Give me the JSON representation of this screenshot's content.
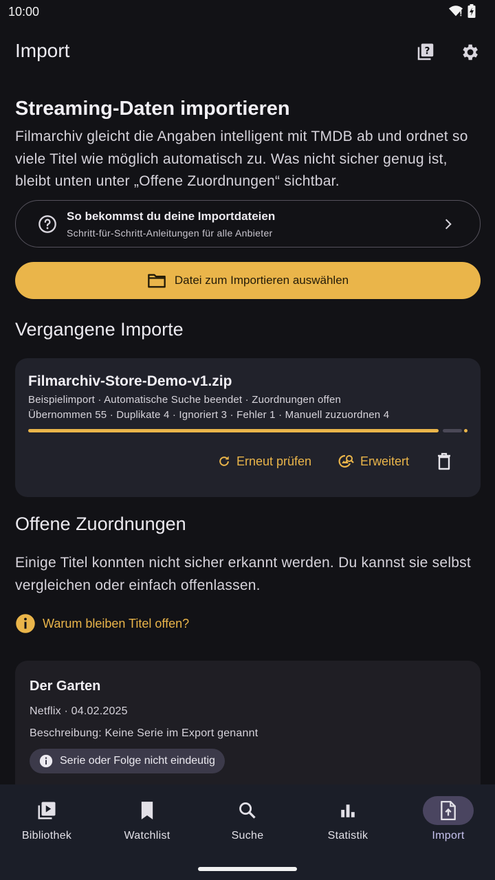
{
  "status_bar": {
    "time": "10:00"
  },
  "app_bar": {
    "title": "Import"
  },
  "hero": {
    "title": "Streaming-Daten importieren",
    "description": "Filmarchiv gleicht die Angaben intelligent mit TMDB ab und ordnet so viele Titel wie möglich automatisch zu. Was nicht sicher genug ist, bleibt unten unter „Offene Zuordnungen“ sichtbar."
  },
  "guide": {
    "title": "So bekommst du deine Importdateien",
    "subtitle": "Schritt-für-Schritt-Anleitungen für alle Anbieter"
  },
  "primary_action": {
    "label": "Datei zum Importieren auswählen"
  },
  "past_imports": {
    "title": "Vergangene Importe",
    "items": [
      {
        "file_name": "Filmarchiv-Store-Demo-v1.zip",
        "status_line": "Beispielimport · Automatische Suche beendet · Zuordnungen offen",
        "stats_line": "Übernommen 55 · Duplikate 4 · Ignoriert 3 · Fehler 1 · Manuell zuzuordnen 4",
        "progress": 0.935,
        "actions": {
          "recheck": "Erneut prüfen",
          "advanced": "Erweitert"
        }
      }
    ]
  },
  "open_matches": {
    "title": "Offene Zuordnungen",
    "description": "Einige Titel konnten nicht sicher erkannt werden. Du kannst sie selbst vergleichen oder einfach offenlassen.",
    "why_link": "Warum bleiben Titel offen?",
    "items": [
      {
        "title": "Der Garten",
        "meta": "Netflix · 04.02.2025",
        "description": "Beschreibung: Keine Serie im Export genannt",
        "chip": "Serie oder Folge nicht eindeutig"
      }
    ]
  },
  "bottom_nav": {
    "items": [
      {
        "label": "Bibliothek",
        "icon": "video-library-icon"
      },
      {
        "label": "Watchlist",
        "icon": "bookmark-icon"
      },
      {
        "label": "Suche",
        "icon": "search-icon"
      },
      {
        "label": "Statistik",
        "icon": "bar-chart-icon"
      },
      {
        "label": "Import",
        "icon": "file-upload-icon"
      }
    ],
    "active_index": 4
  },
  "colors": {
    "background": "#121216",
    "accent": "#EAB54A",
    "card": "#21222B",
    "nav_background": "#1B1E28",
    "nav_active_pill": "#4A4560"
  }
}
